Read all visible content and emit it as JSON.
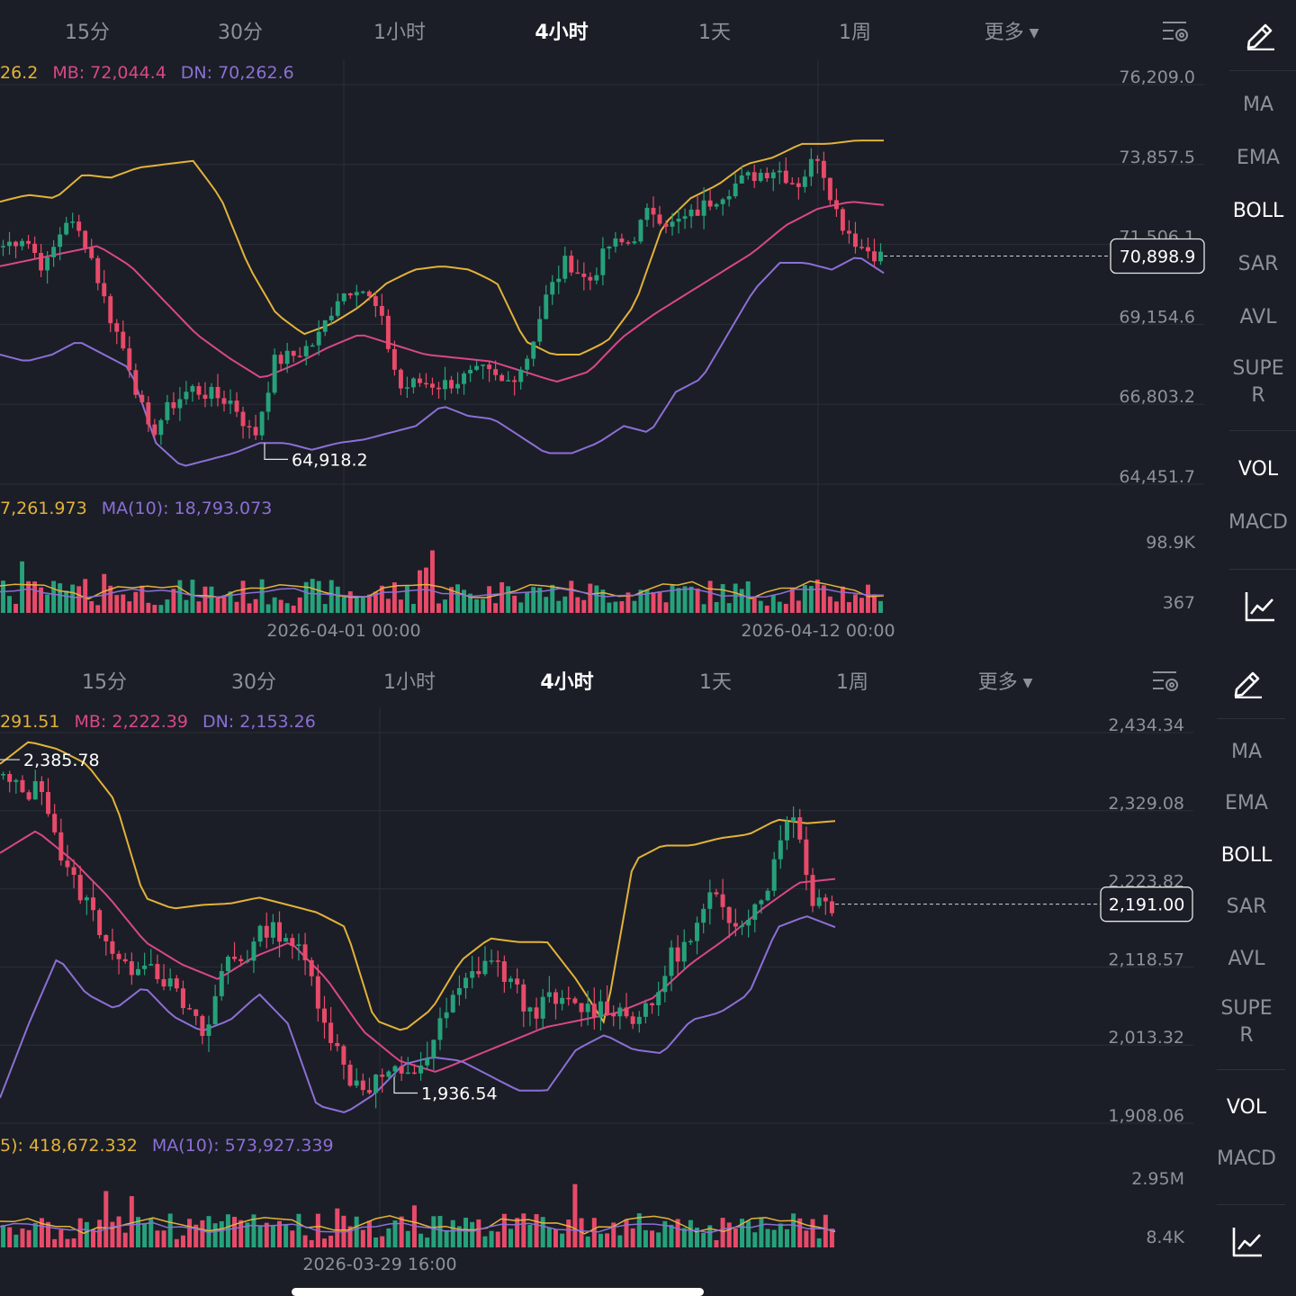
{
  "panels": [
    {
      "tabs": [
        "15分",
        "30分",
        "1小时",
        "4小时",
        "1天",
        "1周",
        "更多"
      ],
      "active_tab": 3,
      "sidebar": [
        "MA",
        "EMA",
        "BOLL",
        "SAR",
        "AVL",
        "SUPE\nR",
        "VOL",
        "MACD"
      ],
      "sidebar_active": [
        "BOLL",
        "VOL"
      ],
      "legend": {
        "up": "26.2",
        "mb": "MB: 72,044.4",
        "dn": "DN: 70,262.6"
      },
      "vol_legend": {
        "val": "7,261.973",
        "ma10": "MA(10): 18,793.073"
      },
      "price_axis": [
        "76,209.0",
        "73,857.5",
        "71,506.1",
        "69,154.6",
        "66,803.2",
        "64,451.7"
      ],
      "current_price": "70,898.9",
      "low_label": "64,918.2",
      "vol_axis": [
        "98.9K",
        "367"
      ],
      "date_labels": [
        "2026-04-01 00:00",
        "2026-04-12 00:00"
      ]
    },
    {
      "tabs": [
        "15分",
        "30分",
        "1小时",
        "4小时",
        "1天",
        "1周",
        "更多"
      ],
      "active_tab": 3,
      "sidebar": [
        "MA",
        "EMA",
        "BOLL",
        "SAR",
        "AVL",
        "SUPE\nR",
        "VOL",
        "MACD"
      ],
      "sidebar_active": [
        "BOLL",
        "VOL"
      ],
      "legend": {
        "up": "291.51",
        "mb": "MB: 2,222.39",
        "dn": "DN: 2,153.26"
      },
      "vol_legend": {
        "val": "5): 418,672.332",
        "ma10": "MA(10): 573,927.339"
      },
      "price_axis": [
        "2,434.34",
        "2,329.08",
        "2,223.82",
        "2,118.57",
        "2,013.32",
        "1,908.06"
      ],
      "current_price": "2,191.00",
      "high_label": "2,385.78",
      "low_label": "1,936.54",
      "vol_axis": [
        "2.95M",
        "8.4K"
      ],
      "date_labels": [
        "2026-03-29 16:00"
      ]
    }
  ],
  "icons": {
    "settings": "indicator-settings-icon",
    "edit": "pencil-icon",
    "chart": "chart-style-icon"
  },
  "colors": {
    "background": "#1b1e26",
    "up": "#26a17b",
    "down": "#e84a6a",
    "boll_up": "#e2b23a",
    "boll_mb": "#d9478a",
    "boll_dn": "#8c6fd6",
    "grid": "#2b2f38",
    "text": "#8c919b"
  },
  "chart_data": [
    {
      "type": "candlestick",
      "timeframe": "4小时",
      "y_axis_ticks": [
        76209.0,
        73857.5,
        71506.1,
        69154.6,
        66803.2,
        64451.7
      ],
      "current_price": 70898.9,
      "marked_low": 64918.2,
      "x_date_labels": [
        "2026-04-01 00:00",
        "2026-04-12 00:00"
      ],
      "close_path": [
        71200,
        71500,
        70500,
        72000,
        71300,
        69300,
        67800,
        65600,
        66500,
        67000,
        66800,
        66600,
        65500,
        67800,
        68000,
        68400,
        69700,
        70100,
        69200,
        67000,
        67200,
        67100,
        67300,
        67500,
        67100,
        67800,
        69700,
        70800,
        70100,
        71200,
        71300,
        72300,
        71800,
        72100,
        72600,
        73000,
        73300,
        73500,
        73000,
        73900,
        72000,
        71200,
        70900
      ],
      "boll_up_path": [
        72500,
        72700,
        72600,
        73300,
        73200,
        73500,
        73600,
        73700,
        72600,
        70600,
        69200,
        68600,
        68900,
        69400,
        70100,
        70500,
        70600,
        70500,
        70100,
        68400,
        68000,
        68000,
        68400,
        69500,
        71800,
        72600,
        73000,
        73600,
        73800,
        74200,
        74200,
        74300,
        74300
      ],
      "boll_mb_path": [
        70600,
        70800,
        71000,
        71200,
        70600,
        69600,
        68600,
        67900,
        67300,
        67700,
        68200,
        68600,
        68300,
        68000,
        67900,
        67800,
        67500,
        67200,
        67500,
        68500,
        69200,
        69800,
        70400,
        71000,
        71800,
        72300,
        72500,
        72400
      ],
      "boll_dn_path": [
        68000,
        67800,
        68000,
        68400,
        68000,
        67600,
        65400,
        64700,
        64900,
        65100,
        65400,
        65400,
        65200,
        65400,
        65500,
        65700,
        65900,
        66500,
        66200,
        66100,
        65600,
        65100,
        65100,
        65400,
        65900,
        65700,
        66900,
        67300,
        68600,
        69900,
        70700,
        70700,
        70500,
        70900,
        70400
      ],
      "volume_axis": [
        "98.9K",
        "367"
      ]
    },
    {
      "type": "candlestick",
      "timeframe": "4小时",
      "y_axis_ticks": [
        2434.34,
        2329.08,
        2223.82,
        2118.57,
        2013.32,
        1908.06
      ],
      "current_price": 2191.0,
      "marked_high": 2385.78,
      "marked_low": 1936.54,
      "x_date_labels": [
        "2026-03-29 16:00"
      ],
      "close_path": [
        2360,
        2340,
        2350,
        2240,
        2200,
        2150,
        2100,
        2120,
        2090,
        2050,
        2010,
        2120,
        2120,
        2160,
        2150,
        2110,
        2030,
        1960,
        1945,
        1965,
        1955,
        1990,
        2050,
        2090,
        2120,
        2090,
        2045,
        2060,
        2055,
        2050,
        2055,
        2040,
        2045,
        2120,
        2140,
        2200,
        2170,
        2180,
        2230,
        2330,
        2200,
        2191
      ],
      "boll_up_path": [
        2380,
        2410,
        2400,
        2380,
        2330,
        2200,
        2185,
        2190,
        2192,
        2200,
        2190,
        2180,
        2160,
        2035,
        2020,
        2050,
        2115,
        2145,
        2140,
        2140,
        2090,
        2030,
        2250,
        2270,
        2270,
        2280,
        2285,
        2305,
        2300,
        2303
      ],
      "boll_mb_path": [
        2260,
        2290,
        2250,
        2200,
        2140,
        2110,
        2090,
        2120,
        2140,
        2090,
        2020,
        1980,
        1965,
        1985,
        2005,
        2025,
        2035,
        2045,
        2065,
        2110,
        2145,
        2185,
        2220,
        2225
      ],
      "boll_dn_path": [
        1930,
        2030,
        2120,
        2070,
        2050,
        2080,
        2040,
        2020,
        2035,
        2070,
        2030,
        1920,
        1910,
        1935,
        1975,
        1985,
        1980,
        1960,
        1940,
        1940,
        1995,
        2015,
        1995,
        1990,
        2035,
        2045,
        2070,
        2160,
        2175,
        2160
      ],
      "volume_axis": [
        "2.95M",
        "8.4K"
      ]
    }
  ]
}
